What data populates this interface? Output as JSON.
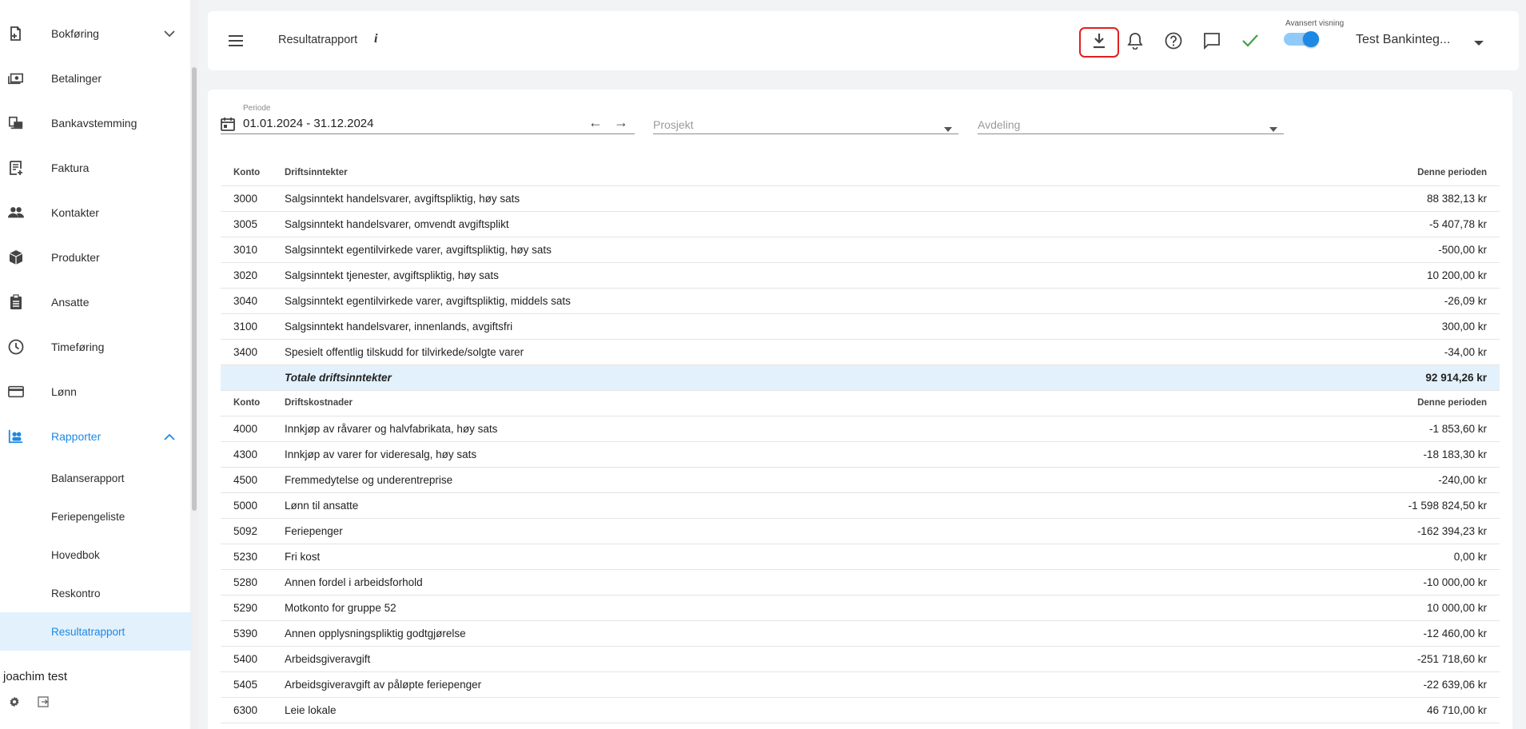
{
  "sidebar": {
    "items": [
      {
        "label": "Bokføring",
        "icon": "bookkeeping-icon"
      },
      {
        "label": "Betalinger",
        "icon": "payments-icon"
      },
      {
        "label": "Bankavstemming",
        "icon": "bank-reconciliation-icon"
      },
      {
        "label": "Faktura",
        "icon": "invoice-icon"
      },
      {
        "label": "Kontakter",
        "icon": "contacts-icon"
      },
      {
        "label": "Produkter",
        "icon": "products-icon"
      },
      {
        "label": "Ansatte",
        "icon": "employees-icon"
      },
      {
        "label": "Timeføring",
        "icon": "clock-icon"
      },
      {
        "label": "Lønn",
        "icon": "payroll-card-icon"
      },
      {
        "label": "Rapporter",
        "icon": "reports-icon"
      }
    ],
    "sub_items": [
      {
        "label": "Balanserapport"
      },
      {
        "label": "Feriepengeliste"
      },
      {
        "label": "Hovedbok"
      },
      {
        "label": "Reskontro"
      },
      {
        "label": "Resultatrapport"
      }
    ],
    "user": "joachim test"
  },
  "header": {
    "title": "Resultatrapport",
    "info": "i",
    "advanced_view_label": "Avansert visning",
    "advanced_view_on": true,
    "company": "Test Bankinteg..."
  },
  "filters": {
    "period_label": "Periode",
    "period_value": "01.01.2024 - 31.12.2024",
    "project_placeholder": "Prosjekt",
    "department_placeholder": "Avdeling"
  },
  "report": {
    "income": {
      "header": {
        "konto": "Konto",
        "name": "Driftsinntekter",
        "period": "Denne perioden"
      },
      "rows": [
        {
          "konto": "3000",
          "name": "Salgsinntekt handelsvarer, avgiftspliktig, høy sats",
          "amount": "88 382,13 kr"
        },
        {
          "konto": "3005",
          "name": "Salgsinntekt handelsvarer, omvendt avgiftsplikt",
          "amount": "-5 407,78 kr"
        },
        {
          "konto": "3010",
          "name": "Salgsinntekt egentilvirkede varer, avgiftspliktig, høy sats",
          "amount": "-500,00 kr"
        },
        {
          "konto": "3020",
          "name": "Salgsinntekt tjenester, avgiftspliktig, høy sats",
          "amount": "10 200,00 kr"
        },
        {
          "konto": "3040",
          "name": "Salgsinntekt egentilvirkede varer, avgiftspliktig, middels sats",
          "amount": "-26,09 kr"
        },
        {
          "konto": "3100",
          "name": "Salgsinntekt handelsvarer, innenlands, avgiftsfri",
          "amount": "300,00 kr"
        },
        {
          "konto": "3400",
          "name": "Spesielt offentlig tilskudd for tilvirkede/solgte varer",
          "amount": "-34,00 kr"
        }
      ],
      "total": {
        "label": "Totale driftsinntekter",
        "amount": "92 914,26 kr"
      }
    },
    "costs": {
      "header": {
        "konto": "Konto",
        "name": "Driftskostnader",
        "period": "Denne perioden"
      },
      "rows": [
        {
          "konto": "4000",
          "name": "Innkjøp av råvarer og halvfabrikata, høy sats",
          "amount": "-1 853,60 kr"
        },
        {
          "konto": "4300",
          "name": "Innkjøp av varer for videresalg, høy sats",
          "amount": "-18 183,30 kr"
        },
        {
          "konto": "4500",
          "name": "Fremmedytelse og underentreprise",
          "amount": "-240,00 kr"
        },
        {
          "konto": "5000",
          "name": "Lønn til ansatte",
          "amount": "-1 598 824,50 kr"
        },
        {
          "konto": "5092",
          "name": "Feriepenger",
          "amount": "-162 394,23 kr"
        },
        {
          "konto": "5230",
          "name": "Fri kost",
          "amount": "0,00 kr"
        },
        {
          "konto": "5280",
          "name": "Annen fordel i arbeidsforhold",
          "amount": "-10 000,00 kr"
        },
        {
          "konto": "5290",
          "name": "Motkonto for gruppe 52",
          "amount": "10 000,00 kr"
        },
        {
          "konto": "5390",
          "name": "Annen opplysningspliktig godtgjørelse",
          "amount": "-12 460,00 kr"
        },
        {
          "konto": "5400",
          "name": "Arbeidsgiveravgift",
          "amount": "-251 718,60 kr"
        },
        {
          "konto": "5405",
          "name": "Arbeidsgiveravgift av påløpte feriepenger",
          "amount": "-22 639,06 kr"
        },
        {
          "konto": "6300",
          "name": "Leie lokale",
          "amount": "46 710,00 kr"
        }
      ]
    }
  },
  "colors": {
    "accent": "#1e88e5",
    "selected_bg": "#e3f1fc",
    "check_green": "#43a047",
    "highlight_red": "#e02020"
  }
}
